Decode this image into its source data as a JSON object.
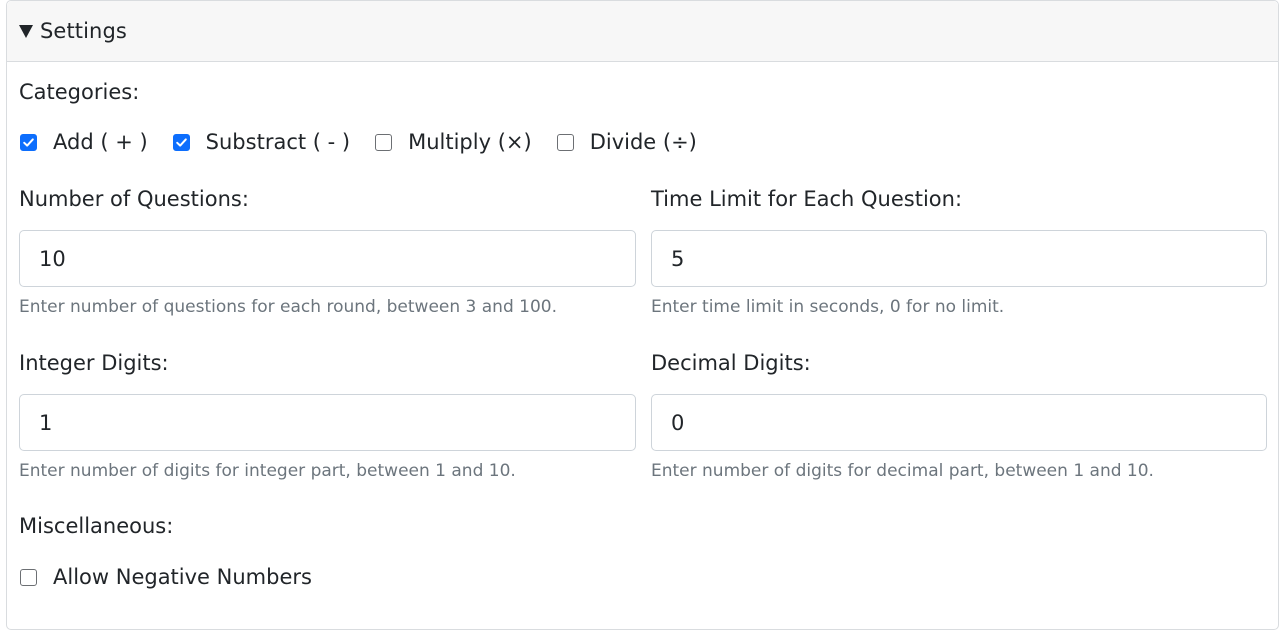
{
  "header": {
    "title": "Settings"
  },
  "categories": {
    "label": "Categories:",
    "items": [
      {
        "label": "Add ( + )",
        "checked": true
      },
      {
        "label": "Substract ( - )",
        "checked": true
      },
      {
        "label": "Multiply (×)",
        "checked": false
      },
      {
        "label": "Divide (÷)",
        "checked": false
      }
    ]
  },
  "fields": {
    "questions": {
      "label": "Number of Questions:",
      "value": "10",
      "help": "Enter number of questions for each round, between 3 and 100."
    },
    "time_limit": {
      "label": "Time Limit for Each Question:",
      "value": "5",
      "help": "Enter time limit in seconds, 0 for no limit."
    },
    "integer_digits": {
      "label": "Integer Digits:",
      "value": "1",
      "help": "Enter number of digits for integer part, between 1 and 10."
    },
    "decimal_digits": {
      "label": "Decimal Digits:",
      "value": "0",
      "help": "Enter number of digits for decimal part, between 1 and 10."
    }
  },
  "misc": {
    "label": "Miscellaneous:",
    "allow_negative": {
      "label": "Allow Negative Numbers",
      "checked": false
    }
  },
  "colors": {
    "accent": "#0d6efd",
    "help_text": "#6c757d",
    "border": "#ced4da"
  }
}
